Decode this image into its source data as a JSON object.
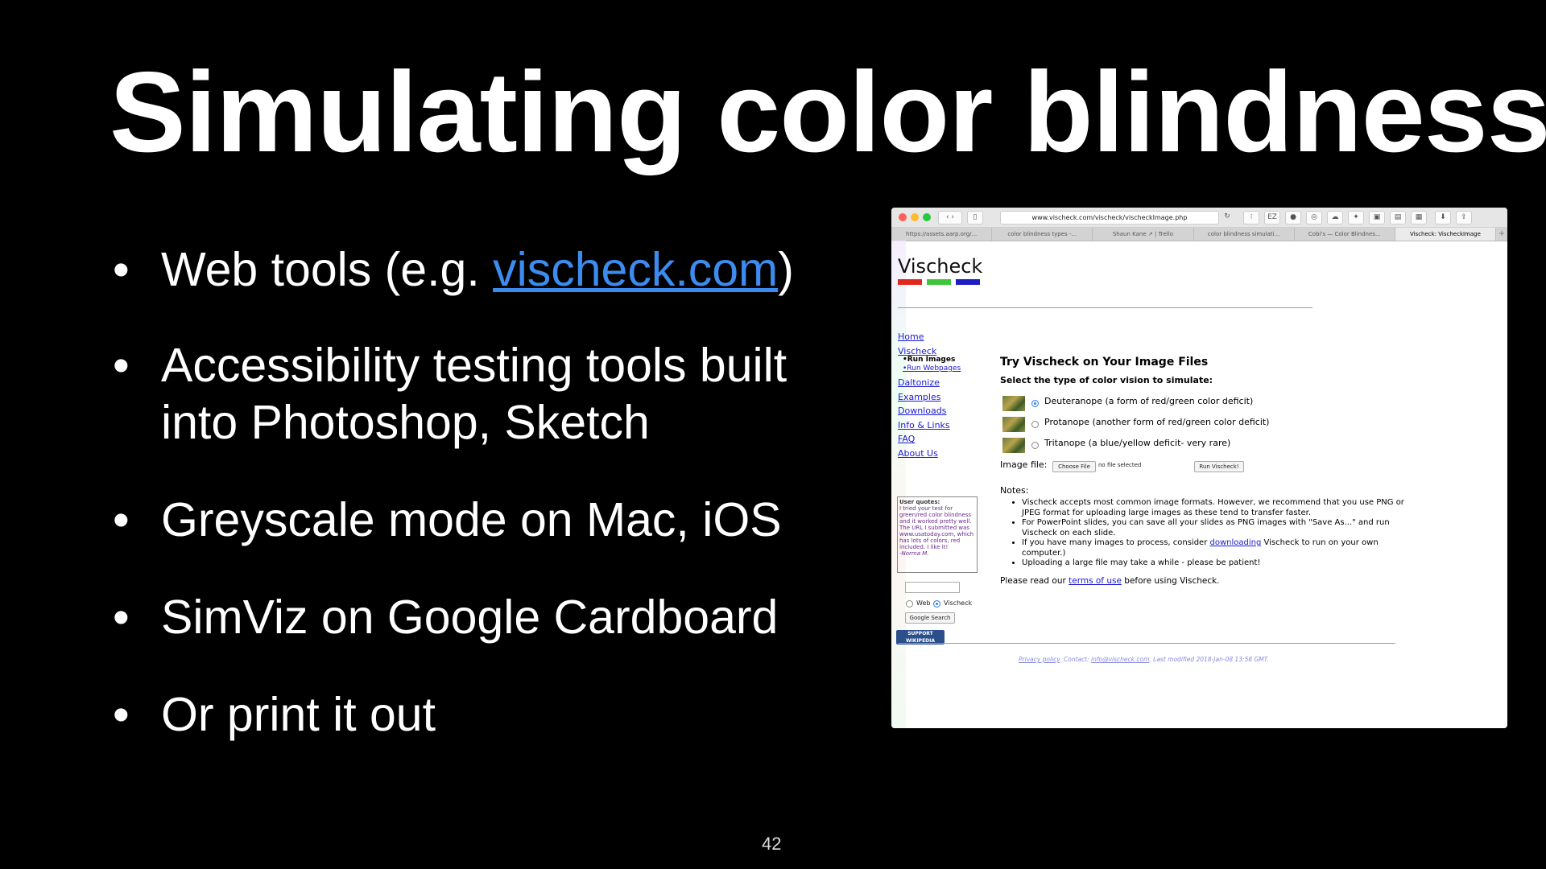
{
  "slide": {
    "title": "Simulating color blindness",
    "bullets": [
      {
        "prefix": "Web tools (e.g. ",
        "link": "vischeck.com",
        "suffix": ")"
      },
      {
        "text": "Accessibility testing tools built into Photoshop, Sketch"
      },
      {
        "text": "Greyscale mode on Mac, iOS"
      },
      {
        "text": "SimViz on Google Cardboard"
      },
      {
        "text": "Or print it out"
      }
    ],
    "page_number": "42"
  },
  "browser": {
    "url": "www.vischeck.com/vischeck/vischeckImage.php",
    "tabs": [
      "https://assets.aarp.org/...",
      "color blindness types -...",
      "Shaun Kane ↗ | Trello",
      "color blindness simulati...",
      "Cobi's — Color Blindnes...",
      "Vischeck: VischeckImage"
    ],
    "active_tab": 5,
    "toolbar_icons": [
      "back-icon",
      "forward-icon",
      "sidebar-icon",
      "reload-icon",
      "share-icon",
      "new-tab-icon"
    ]
  },
  "website": {
    "logo": "Vischeck",
    "logo_colors": [
      "#e0281e",
      "#3fc53a",
      "#1d1dc8"
    ],
    "nav": {
      "home": "Home",
      "vischeck": "Vischeck",
      "run_images": "•Run Images",
      "run_webpages": "•Run Webpages",
      "daltonize": "Daltonize",
      "examples": "Examples",
      "downloads": "Downloads",
      "info_links": "Info & Links",
      "faq": "FAQ",
      "about": "About Us"
    },
    "quote": {
      "heading": "User quotes:",
      "text": "I tried your test for green/red color blindness and it worked pretty well. The URL I submitted was www.usatoday.com, which has lots of colors, red included. I like it!",
      "author": "-Norma M."
    },
    "search": {
      "option_web": "Web",
      "option_vischeck": "Vischeck",
      "button": "Google Search"
    },
    "wiki_badge": "SUPPORT WIKIPEDIA",
    "heading": "Try Vischeck on Your Image Files",
    "subheading": "Select the type of color vision to simulate:",
    "options": [
      {
        "label": "Deuteranope (a form of red/green color deficit)",
        "selected": true
      },
      {
        "label": "Protanope (another form of red/green color deficit)",
        "selected": false
      },
      {
        "label": "Tritanope (a blue/yellow deficit- very rare)",
        "selected": false
      }
    ],
    "file_label": "Image file:",
    "choose_file": "Choose File",
    "no_file": "no file selected",
    "run_button": "Run Vischeck!",
    "notes_heading": "Notes:",
    "notes": [
      "Vischeck accepts most common image formats. However, we recommend that you use PNG or JPEG format for uploading large images as these tend to transfer faster.",
      "For PowerPoint slides, you can save all your slides as PNG images with \"Save As...\" and run Vischeck on each slide.",
      "Uploading a large file may take a while - please be patient!"
    ],
    "note_dl_prefix": "If you have many images to process, consider ",
    "note_dl_link": "downloading",
    "note_dl_suffix": " Vischeck to run on your own computer.)",
    "read_prefix": "Please read our ",
    "read_link": "terms of use",
    "read_suffix": " before using Vischeck.",
    "footer_privacy": "Privacy policy",
    "footer_contact": ". Contact: ",
    "footer_email": "info@vischeck.com",
    "footer_modified": ". Last modified 2018-Jan-08 13:58 GMT."
  }
}
